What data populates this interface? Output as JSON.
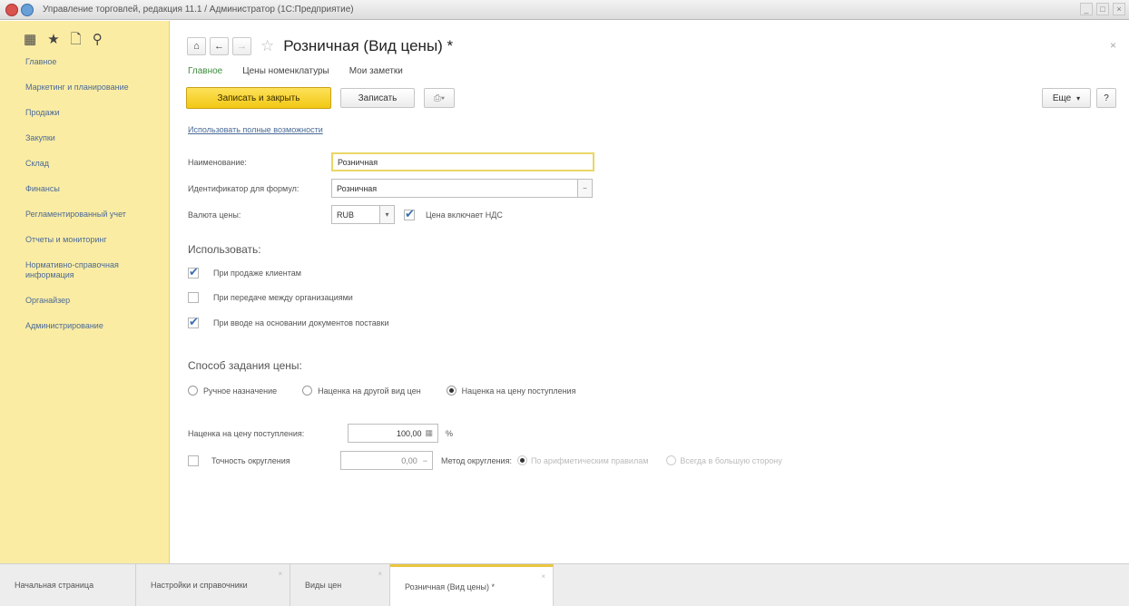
{
  "window": {
    "title": "Управление торговлей, редакция 11.1 / Администратор (1С:Предприятие)"
  },
  "sidebar": {
    "tools": [
      "▦",
      "★",
      "🗋",
      "⚲"
    ],
    "items": [
      {
        "label": "Главное"
      },
      {
        "label": "Маркетинг и планирование"
      },
      {
        "label": "Продажи"
      },
      {
        "label": "Закупки"
      },
      {
        "label": "Склад"
      },
      {
        "label": "Финансы"
      },
      {
        "label": "Регламентированный учет"
      },
      {
        "label": "Отчеты и мониторинг"
      },
      {
        "label": "Нормативно-справочная информация"
      },
      {
        "label": "Органайзер"
      },
      {
        "label": "Администрирование"
      }
    ]
  },
  "header": {
    "title": "Розничная (Вид цены) *",
    "home_icon": "home-icon",
    "back_icon": "arrow-left-icon",
    "forward_icon": "arrow-right-icon"
  },
  "tabs": [
    {
      "label": "Главное",
      "active": true
    },
    {
      "label": "Цены номенклатуры",
      "active": false
    },
    {
      "label": "Мои заметки",
      "active": false
    }
  ],
  "toolbar": {
    "save_close": "Записать и закрыть",
    "save": "Записать",
    "more": "Еще",
    "help": "?"
  },
  "link_full": "Использовать полные возможности",
  "form": {
    "name_label": "Наименование:",
    "name_value": "Розничная",
    "id_label": "Идентификатор для формул:",
    "id_value": "Розничная",
    "currency_label": "Валюта цены:",
    "currency_value": "RUB",
    "vat_label": "Цена включает НДС",
    "vat_checked": true
  },
  "use": {
    "title": "Использовать:",
    "options": [
      {
        "label": "При продаже клиентам",
        "checked": true
      },
      {
        "label": "При передаче между организациями",
        "checked": false
      },
      {
        "label": "При вводе на основании документов поставки",
        "checked": true
      }
    ]
  },
  "pricing": {
    "title": "Способ задания цены:",
    "methods": [
      {
        "label": "Ручное назначение",
        "selected": false
      },
      {
        "label": "Наценка на другой вид цен",
        "selected": false
      },
      {
        "label": "Наценка на цену поступления",
        "selected": true
      }
    ],
    "markup_label": "Наценка на цену поступления:",
    "markup_value": "100,00",
    "markup_unit": "%",
    "rounding_label": "Точность округления",
    "rounding_checked": false,
    "rounding_value": "0,00",
    "round_method_label": "Метод округления:",
    "round_methods": [
      {
        "label": "По арифметическим правилам",
        "selected": true
      },
      {
        "label": "Всегда в большую сторону",
        "selected": false
      }
    ]
  },
  "bottom_tabs": [
    {
      "label": "Начальная страница",
      "active": false
    },
    {
      "label": "Настройки и справочники",
      "active": false
    },
    {
      "label": "Виды цен",
      "active": false
    },
    {
      "label": "Розничная (Вид цены) *",
      "active": true
    }
  ]
}
